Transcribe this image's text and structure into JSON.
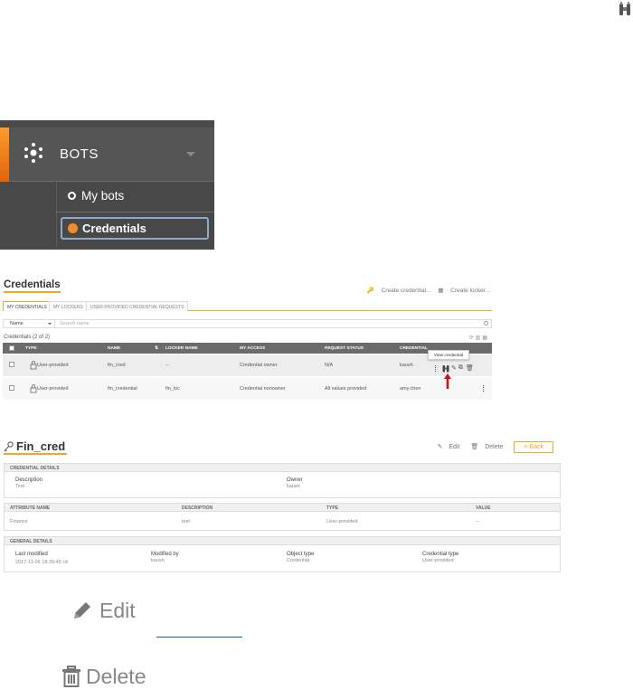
{
  "sidebar": {
    "section_label": "BOTS",
    "items": [
      {
        "label": "My bots"
      },
      {
        "label": "Credentials"
      }
    ]
  },
  "credentials_page": {
    "title": "Credentials",
    "actions": {
      "create_credential": "Create credential...",
      "create_locker": "Create locker..."
    },
    "tabs": [
      {
        "label": "MY CREDENTIALS",
        "active": true
      },
      {
        "label": "MY LOCKERS"
      },
      {
        "label": "USER-PROVIDED CREDENTIAL REQUESTS"
      }
    ],
    "search": {
      "field": "Name",
      "placeholder": "Search name"
    },
    "count_text": "Credentials (2 of 2)",
    "columns": [
      "TYPE",
      "NAME",
      "LOCKER NAME",
      "MY ACCESS",
      "REQUEST STATUS",
      "CREDENTIAL"
    ],
    "rows": [
      {
        "type": "User-provided",
        "name": "fin_cred",
        "locker": "--",
        "access": "Credential owner",
        "status": "N/A",
        "owner": "kaush"
      },
      {
        "type": "User-provided",
        "name": "fin_credential",
        "locker": "fin_loc",
        "access": "Credential nonowner",
        "status": "All values provided",
        "owner": "amy.chen"
      }
    ],
    "tooltip": "View credential"
  },
  "detail": {
    "title": "Fin_cred",
    "edit_label": "Edit",
    "delete_label": "Delete",
    "back_label": "< Back",
    "credential_details": {
      "header": "CREDENTIAL DETAILS",
      "description_label": "Description",
      "description_value": "Test",
      "owner_label": "Owner",
      "owner_value": "kaush"
    },
    "attributes": {
      "columns": [
        "ATTRIBUTE NAME",
        "DESCRIPTION",
        "TYPE",
        "VALUE"
      ],
      "row": {
        "name": "Finance",
        "description": "test",
        "type": "User-provided",
        "value": "--"
      }
    },
    "general_details": {
      "header": "GENERAL DETAILS",
      "last_modified_label": "Last modified",
      "last_modified_value": "2017-11-06 18:39:45 ㎝",
      "modified_by_label": "Modified by",
      "modified_by_value": "kaush",
      "object_type_label": "Object type",
      "object_type_value": "Credential",
      "credential_type_label": "Credential type",
      "credential_type_value": "User-provided"
    }
  },
  "large_buttons": {
    "edit": "Edit",
    "delete": "Delete"
  },
  "colors": {
    "accent": "#f5a623",
    "sidebar_bg": "#4a4a4a",
    "arrow": "#c0151b",
    "link": "#1a57c7"
  },
  "icons": [
    "binoculars-icon",
    "bots-icon",
    "key-icon",
    "pencil-icon",
    "trash-icon",
    "lock-person-icon",
    "refresh-icon",
    "columns-icon"
  ]
}
